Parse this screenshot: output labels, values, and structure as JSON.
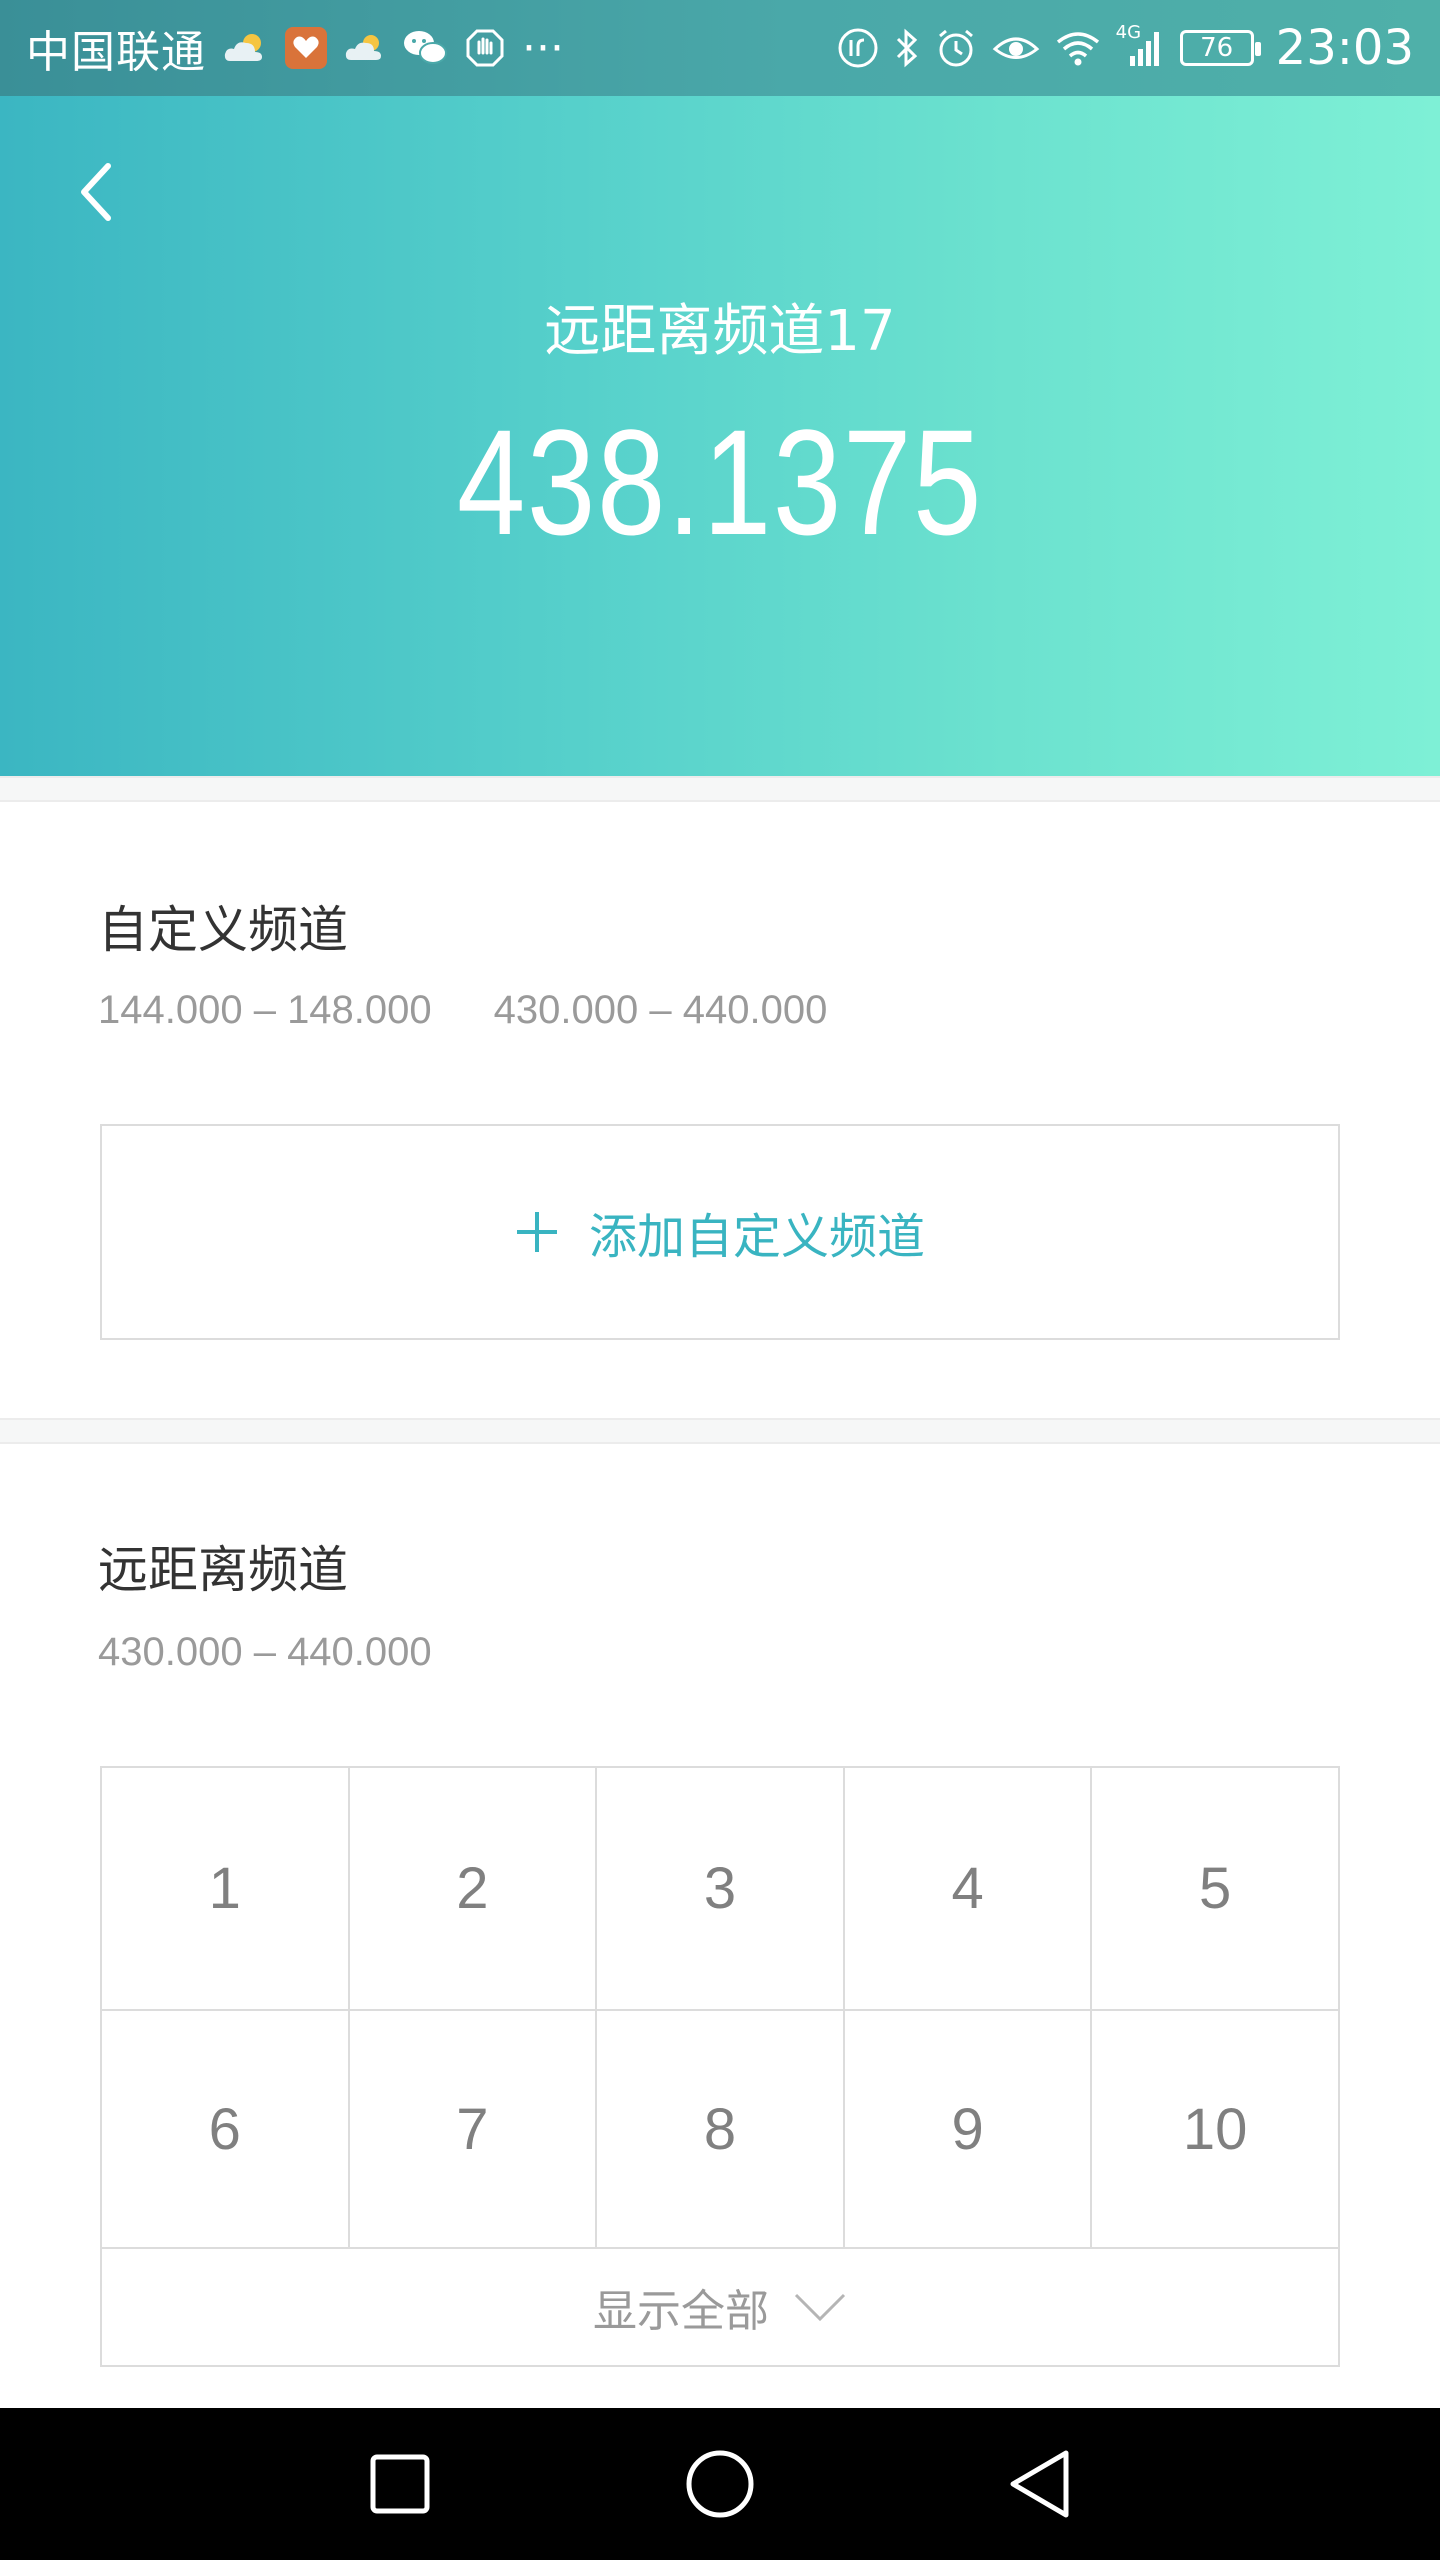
{
  "status_bar": {
    "carrier": "中国联通",
    "more": "···",
    "battery": "76",
    "time": "23:03",
    "network": "4G",
    "icons": [
      "weather-cloud-icon",
      "health-app-icon",
      "weather-icon",
      "wechat-icon",
      "hand-icon",
      "no-disturb-icon",
      "bluetooth-icon",
      "alarm-icon",
      "eye-care-icon",
      "wifi-icon",
      "signal-icon",
      "battery-icon"
    ]
  },
  "header": {
    "back_icon": "chevron-left-icon",
    "channel_name": "远距离频道17",
    "frequency": "438.1375"
  },
  "custom_section": {
    "title": "自定义频道",
    "ranges": [
      "144.000 – 148.000",
      "430.000 – 440.000"
    ],
    "add_icon": "plus-icon",
    "add_label": "添加自定义频道"
  },
  "long_range_section": {
    "title": "远距离频道",
    "range": "430.000 – 440.000",
    "channels_row1": [
      "1",
      "2",
      "3",
      "4",
      "5"
    ],
    "channels_row2": [
      "6",
      "7",
      "8",
      "9",
      "10"
    ],
    "show_all_label": "显示全部",
    "show_all_icon": "chevron-down-icon"
  },
  "nav_bar": {
    "buttons": [
      "recent-apps-icon",
      "home-icon",
      "back-icon"
    ]
  },
  "colors": {
    "accent": "#39b4c1",
    "header_gradient_start": "#3bb6c2",
    "header_gradient_end": "#7ef0d6"
  }
}
